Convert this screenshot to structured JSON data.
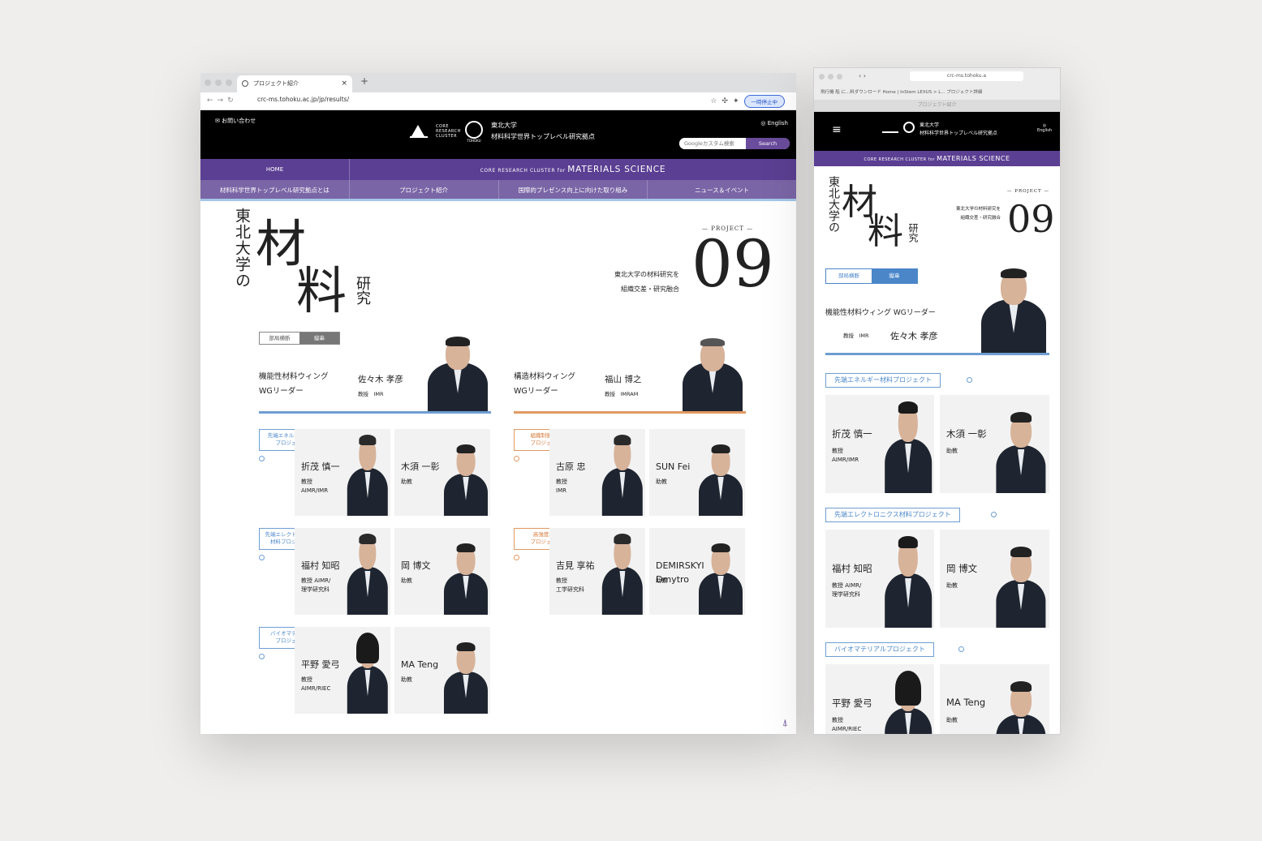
{
  "browser": {
    "tab_title": "プロジェクト紹介",
    "url": "crc-ms.tohoku.ac.jp/jp/results/",
    "pause_label": "一時停止中"
  },
  "site": {
    "contact": "お問い合わせ",
    "univ": "東北大学",
    "center": "材料科学世界トップレベル研究拠点",
    "crc_mark": "CORE RESEARCH CLUSTER",
    "tohoku": "TOHOKU",
    "english": "English",
    "search_placeholder": "Googleカスタム検索",
    "search_button": "Search",
    "nav_home": "HOME",
    "nav_crc_prefix": "CORE RESEARCH CLUSTER for",
    "nav_crc_main": "MATERIALS SCIENCE",
    "nav_items": [
      "材料科学世界トップレベル研究拠点とは",
      "プロジェクト紹介",
      "国際的プレゼンス向上に向けた取り組み",
      "ニュース＆イベント"
    ]
  },
  "hero": {
    "small_title": "東北大学の",
    "char1": "材",
    "char2": "料",
    "tail": "研究",
    "project_label": "PROJECT",
    "tagline1": "東北大学の材料研究を",
    "tagline2": "組織交差・研究融合",
    "number": "09"
  },
  "toggle": {
    "off": "部局横断",
    "on": "縦串"
  },
  "wings": [
    {
      "wing": "機能性材料ウィング",
      "wg": "WGリーダー",
      "name": "佐々木 孝彦",
      "title": "教授",
      "org": "IMR",
      "accent": "#6e9ed3"
    },
    {
      "wing": "構造材料ウィング",
      "wg": "WGリーダー",
      "name": "福山 博之",
      "title": "教授",
      "org": "IMRAM",
      "accent": "#e09a62"
    }
  ],
  "projects_left": [
    {
      "badge": "先端エネルギー材料\nプロジェクト",
      "lead": "折茂 慎一",
      "lead_role": "教授\nAIMR/IMR",
      "sub": "木須 一彰",
      "sub_role": "助教"
    },
    {
      "badge": "先端エレクトロニクス\n材料プロジェクト",
      "lead": "福村 知昭",
      "lead_role": "教授 AIMR/\n理学研究科",
      "sub": "岡 博文",
      "sub_role": "助教"
    },
    {
      "badge": "バイオマテリアル\nプロジェクト",
      "lead": "平野 愛弓",
      "lead_role": "教授\nAIMR/RIEC",
      "sub": "MA Teng",
      "sub_role": "助教"
    }
  ],
  "projects_right": [
    {
      "badge": "組織制御材料\nプロジェクト",
      "lead": "古原 忠",
      "lead_role": "教授\nIMR",
      "sub": "SUN Fei",
      "sub_role": "助教"
    },
    {
      "badge": "高強度材料\nプロジェクト",
      "lead": "吉見 享祐",
      "lead_role": "教授\n工学研究科",
      "sub": "DEMIRSKYI\nDmytro",
      "sub_role": "助教"
    }
  ],
  "mobile": {
    "url": "crc-ms.tohoku.a",
    "bookmarks": "飛行機  船 に...料ダウンロード   Home | InStem   LEXUS > L...  プロジェクト詳細",
    "tab": "プロジェクト紹介",
    "wing": "機能性材料ウィング  WGリーダー",
    "lead_title": "教授",
    "lead_org": "IMR",
    "lead_name": "佐々木 孝彦",
    "sections": [
      {
        "badge": "先端エネルギー材料プロジェクト",
        "lead": "折茂 慎一",
        "lead_role": "教授\nAIMR/IMR",
        "sub": "木須 一彰",
        "sub_role": "助教"
      },
      {
        "badge": "先端エレクトロニクス材料プロジェクト",
        "lead": "福村 知昭",
        "lead_role": "教授 AIMR/\n理学研究科",
        "sub": "岡 博文",
        "sub_role": "助教"
      },
      {
        "badge": "バイオマテリアルプロジェクト",
        "lead": "平野 愛弓",
        "lead_role": "教授\nAIMR/RIEC",
        "sub": "MA Teng",
        "sub_role": "助教"
      }
    ]
  }
}
